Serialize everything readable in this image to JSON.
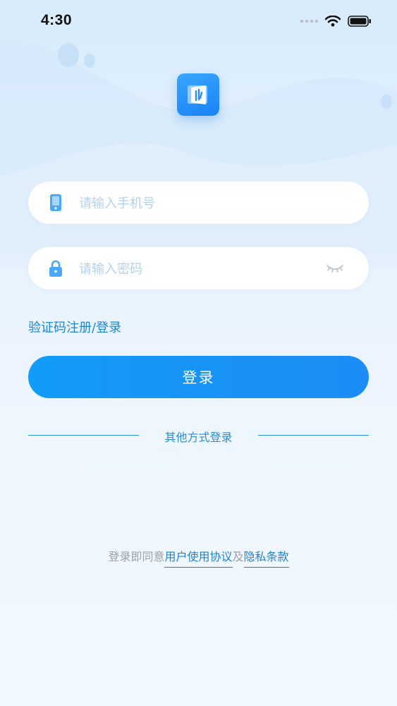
{
  "status_bar": {
    "time": "4:30"
  },
  "form": {
    "phone_placeholder": "请输入手机号",
    "password_placeholder": "请输入密码",
    "sms_link": "验证码注册/登录",
    "login_button": "登录"
  },
  "other_methods": {
    "label": "其他方式登录"
  },
  "agreement": {
    "prefix": "登录即同意",
    "user_agreement": "用户使用协议",
    "conjunction": "及",
    "privacy": "隐私条款"
  },
  "colors": {
    "accent": "#1a8ff5",
    "link": "#1f85d8",
    "placeholder": "#b2d2ee"
  }
}
